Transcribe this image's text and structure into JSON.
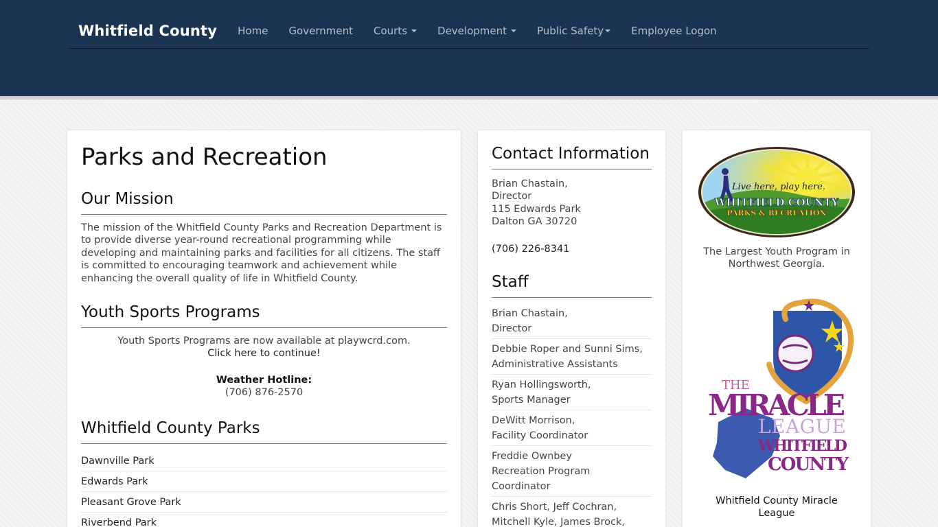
{
  "nav": {
    "brand": "Whitfield County",
    "items": [
      {
        "label": "Home"
      },
      {
        "label": "Government"
      },
      {
        "label": "Courts"
      },
      {
        "label": "Development"
      },
      {
        "label": "Public Safety"
      },
      {
        "label": "Employee Logon"
      }
    ]
  },
  "main": {
    "title": "Parks and Recreation",
    "mission_heading": "Our Mission",
    "mission_text": "The mission of the Whitfield County Parks and Recreation Department is to provide diverse year-round recreational programming while developing and maintaining parks and facilities for all citizens. The staff is committed to encouraging teamwork and achievement while enhancing the overall quality of life in Whitfield County.",
    "youth_heading": "Youth Sports Programs",
    "youth_text": "Youth Sports Programs are now available at playwcrd.com.",
    "youth_link": "Click here to continue!",
    "hotline_label": "Weather Hotline:",
    "hotline_phone": "(706) 876-2570",
    "parks_heading": "Whitfield County Parks",
    "parks": [
      "Dawnville Park",
      "Edwards Park",
      "Pleasant Grove Park",
      "Riverbend Park"
    ]
  },
  "contact": {
    "heading": "Contact Information",
    "name": "Brian Chastain,",
    "role": "Director",
    "address1": "115 Edwards Park",
    "address2": "Dalton GA 30720",
    "phone": "(706) 226-8341",
    "staff_heading": "Staff",
    "staff": [
      {
        "name": "Brian Chastain,",
        "role": "Director"
      },
      {
        "name": "Debbie Roper and Sunni Sims,",
        "role": "Administrative Assistants"
      },
      {
        "name": "Ryan Hollingsworth,",
        "role": "Sports Manager"
      },
      {
        "name": "DeWitt Morrison,",
        "role": "Facility Coordinator"
      },
      {
        "name": "Freddie Ownbey",
        "role": "Recreation Program Coordinator"
      },
      {
        "name": "Chris Short, Jeff Cochran,",
        "role": "Mitchell Kyle, James Brock,"
      }
    ]
  },
  "sidebar": {
    "logo1": {
      "slogan": "Live here, play here.",
      "line1": "WHITFIELD COUNTY",
      "line2": "PARKS & RECREATION",
      "caption": "The Largest Youth Program in Northwest Georgia."
    },
    "logo2": {
      "the": "THE",
      "miracle": "MIRACLE",
      "league": "LEAGUE",
      "whitfield": "WHITFIELD",
      "county": "COUNTY",
      "caption": "Whitfield County Miracle League"
    }
  }
}
